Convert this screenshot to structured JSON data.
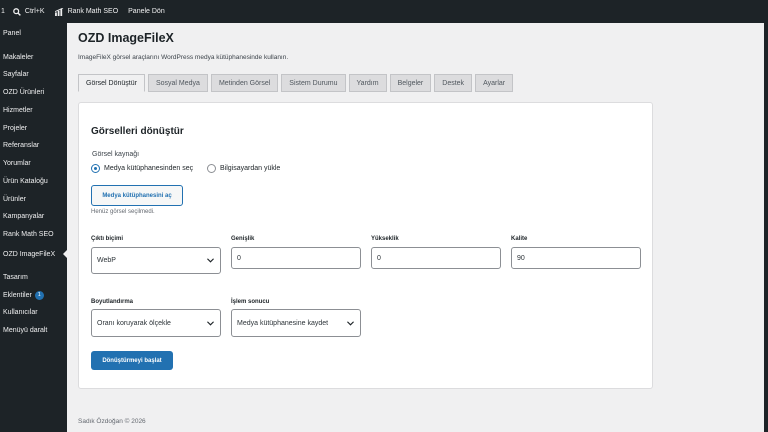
{
  "adminbar": {
    "count": "1",
    "shortcut": "Ctrl+K",
    "rank_math": "Rank Math SEO",
    "panel_return": "Panele Dön"
  },
  "sidebar": {
    "items": [
      {
        "label": "Panel"
      },
      {
        "label": "Makaleler"
      },
      {
        "label": "Sayfalar"
      },
      {
        "label": "OZD Ürünleri"
      },
      {
        "label": "Hizmetler"
      },
      {
        "label": "Projeler"
      },
      {
        "label": "Referanslar"
      },
      {
        "label": "Yorumlar"
      },
      {
        "label": "Ürün Kataloğu"
      },
      {
        "label": "Ürünler"
      },
      {
        "label": "Kampanyalar"
      },
      {
        "label": "Rank Math SEO"
      },
      {
        "label": "OZD ImageFileX"
      },
      {
        "label": "Tasarım"
      },
      {
        "label": "Eklentiler",
        "badge": "1"
      },
      {
        "label": "Kullanıcılar"
      },
      {
        "label": "Menüyü daralt"
      }
    ]
  },
  "page": {
    "title": "OZD ImageFileX",
    "description": "ImageFileX görsel araçlarını WordPress medya kütüphanesinde kullanın."
  },
  "tabs": [
    {
      "label": "Görsel Dönüştür",
      "active": true
    },
    {
      "label": "Sosyal Medya"
    },
    {
      "label": "Metinden Görsel"
    },
    {
      "label": "Sistem Durumu"
    },
    {
      "label": "Yardım"
    },
    {
      "label": "Belgeler"
    },
    {
      "label": "Destek"
    },
    {
      "label": "Ayarlar"
    }
  ],
  "form": {
    "section_title": "Görselleri dönüştür",
    "source_label": "Görsel kaynağı",
    "source_options": [
      "Medya kütüphanesinden seç",
      "Bilgisayardan yükle"
    ],
    "source_selected": "Medya kütüphanesinden seç",
    "media_button": "Medya kütüphanesini aç",
    "media_note": "Henüz görsel seçilmedi.",
    "output_format": {
      "label": "Çıktı biçimi",
      "value": "WebP"
    },
    "width": {
      "label": "Genişlik",
      "value": "0"
    },
    "height": {
      "label": "Yükseklik",
      "value": "0"
    },
    "quality": {
      "label": "Kalite",
      "value": "90"
    },
    "resize": {
      "label": "Boyutlandırma",
      "value": "Oranı koruyarak ölçekle"
    },
    "result": {
      "label": "İşlem sonucu",
      "value": "Medya kütüphanesine kaydet"
    },
    "submit_button": "Dönüştürmeyi başlat"
  },
  "footer": {
    "text": "Sadık Özdoğan © 2026"
  },
  "colors": {
    "accent": "#2271b1",
    "admin_dark": "#1d2327",
    "background": "#f0f0f1"
  }
}
